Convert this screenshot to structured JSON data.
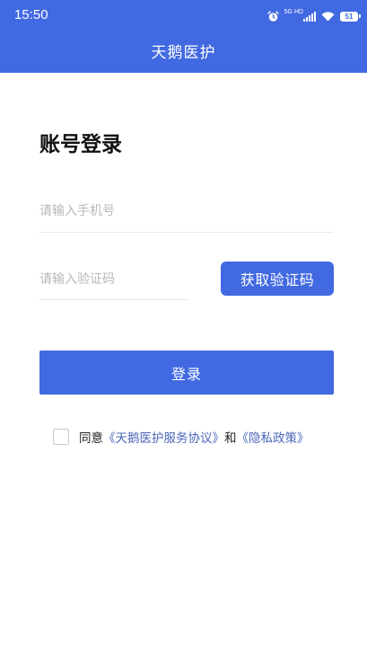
{
  "status_bar": {
    "time": "15:50",
    "network_label": "5G HD",
    "battery_level": "51",
    "icons": [
      "alarm-icon",
      "signal-icon",
      "wifi-icon",
      "battery-icon"
    ]
  },
  "app": {
    "title": "天鹅医护"
  },
  "login": {
    "heading": "账号登录",
    "phone_placeholder": "请输入手机号",
    "phone_value": "",
    "code_placeholder": "请输入验证码",
    "code_value": "",
    "get_code_label": "获取验证码",
    "submit_label": "登录"
  },
  "agreement": {
    "checked": false,
    "prefix": "同意",
    "service_link": "《天鹅医护服务协议》",
    "connector": "和",
    "privacy_link": "《隐私政策》"
  },
  "colors": {
    "primary": "#4169e1",
    "link": "#4a66b8",
    "placeholder": "#b8b8b8"
  }
}
